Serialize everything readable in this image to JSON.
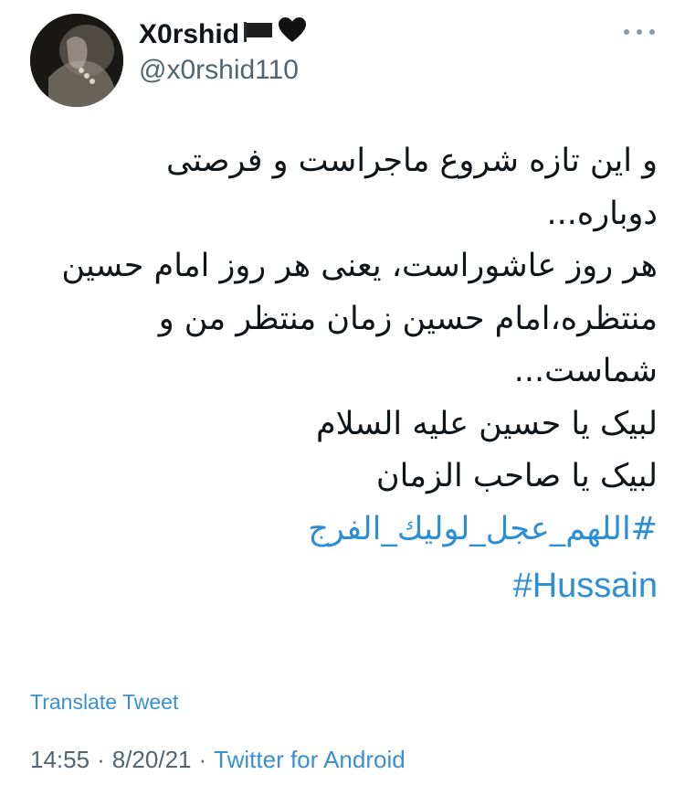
{
  "author": {
    "display_name": "X0rshid",
    "handle": "@x0rshid110",
    "flag_icon": "black-flag-icon",
    "heart_icon": "black-heart-icon"
  },
  "more_icon": "more-horizontal-icon",
  "tweet": {
    "lines": [
      "و این تازه شروع ماجراست و فرصتی",
      "دوباره...",
      "هر روز عاشوراست، یعنی هر روز امام حسین",
      "منتظره،امام حسین زمان منتظر من و",
      "شماست...",
      "لبیک یا حسین علیه السلام",
      "لبیک یا صاحب الزمان"
    ],
    "hashtags": [
      "#اللهم_عجل_لولیك_الفرج",
      "#Hussain"
    ]
  },
  "translate_label": "Translate Tweet",
  "meta": {
    "time": "14:55",
    "sep1": "·",
    "date": "8/20/21",
    "sep2": "·",
    "source": "Twitter for Android"
  },
  "colors": {
    "link": "#2b8ed6",
    "muted": "#536471",
    "text": "#0f1419"
  }
}
